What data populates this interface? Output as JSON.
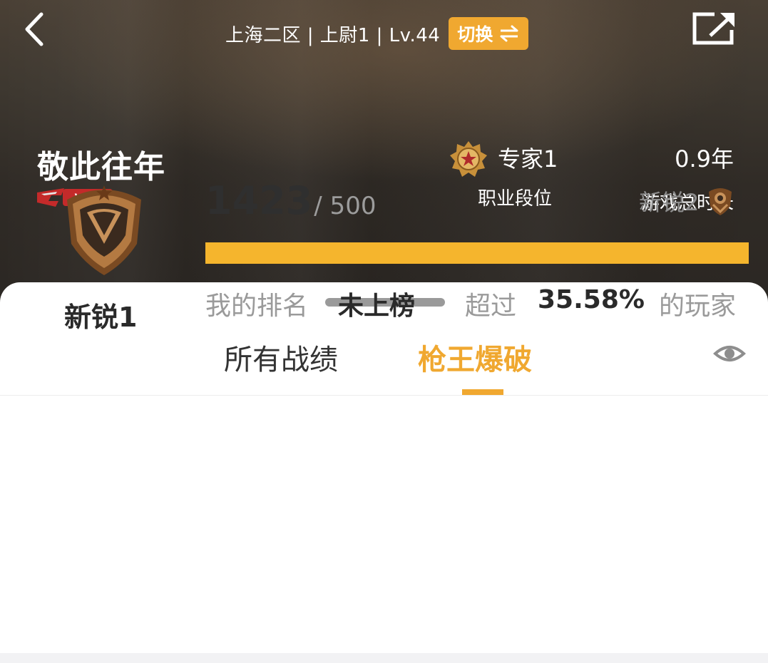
{
  "header": {
    "server_info": "上海二区 | 上尉1 | Lv.44",
    "switch_label": "切换",
    "switch_icon": "swap-arrows-icon",
    "back_icon": "chevron-left-icon",
    "share_icon": "share-external-icon"
  },
  "profile": {
    "name": "敬此往年",
    "vip_badge": "VIP6",
    "vip_logo": "CF"
  },
  "stats": {
    "rank_value": "专家1",
    "rank_label": "职业段位",
    "time_value": "0.9年",
    "time_label": "游戏总时长"
  },
  "tabs": [
    {
      "label": "所有战绩",
      "active": false
    },
    {
      "label": "枪王爆破",
      "active": true
    }
  ],
  "visibility_icon": "eye-icon",
  "season": {
    "current_rank": "新锐1",
    "score": "1423",
    "score_target": "/ 500",
    "next_rank": "新锐2",
    "progress": 1.0,
    "ranking_label": "我的排名",
    "ranking_value": "未上榜",
    "exceed_label": "超过",
    "exceed_percent": "35.58%",
    "exceed_suffix": "的玩家"
  },
  "colors": {
    "accent": "#f0a830",
    "progress_fill": "#f5b52d",
    "header_bg": "#2b2723",
    "vip_red": "#c42a2a"
  }
}
